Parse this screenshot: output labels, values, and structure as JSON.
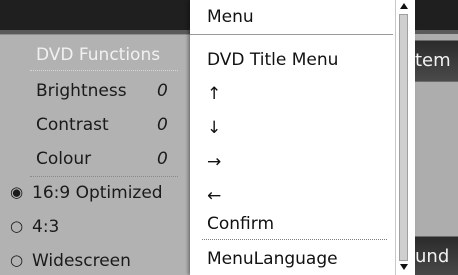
{
  "popup": {
    "title": "Menu",
    "items": [
      {
        "label": "DVD Title Menu"
      },
      {
        "label": "↑"
      },
      {
        "label": "↓"
      },
      {
        "label": "→"
      },
      {
        "label": "←"
      },
      {
        "label": "Confirm"
      },
      {
        "label": "MenuLanguage"
      }
    ]
  },
  "left_menu": {
    "header": "DVD Functions",
    "items": [
      {
        "label": "Brightness",
        "value": "0"
      },
      {
        "label": "Contrast",
        "value": "0"
      },
      {
        "label": "Colour",
        "value": "0"
      }
    ],
    "formats": [
      {
        "label": "16:9 Optimized",
        "radio": "◉"
      },
      {
        "label": "4:3",
        "radio": "○"
      },
      {
        "label": "Widescreen",
        "radio": "○"
      }
    ]
  },
  "right_menu": {
    "top_label": "tem",
    "bottom_label": "und"
  },
  "colors": {
    "popup_bg": "#ffffff",
    "menu_bg": "#b2b2b2",
    "header_text": "#f1f1f1",
    "scene_bg": "#5f5f5f"
  }
}
